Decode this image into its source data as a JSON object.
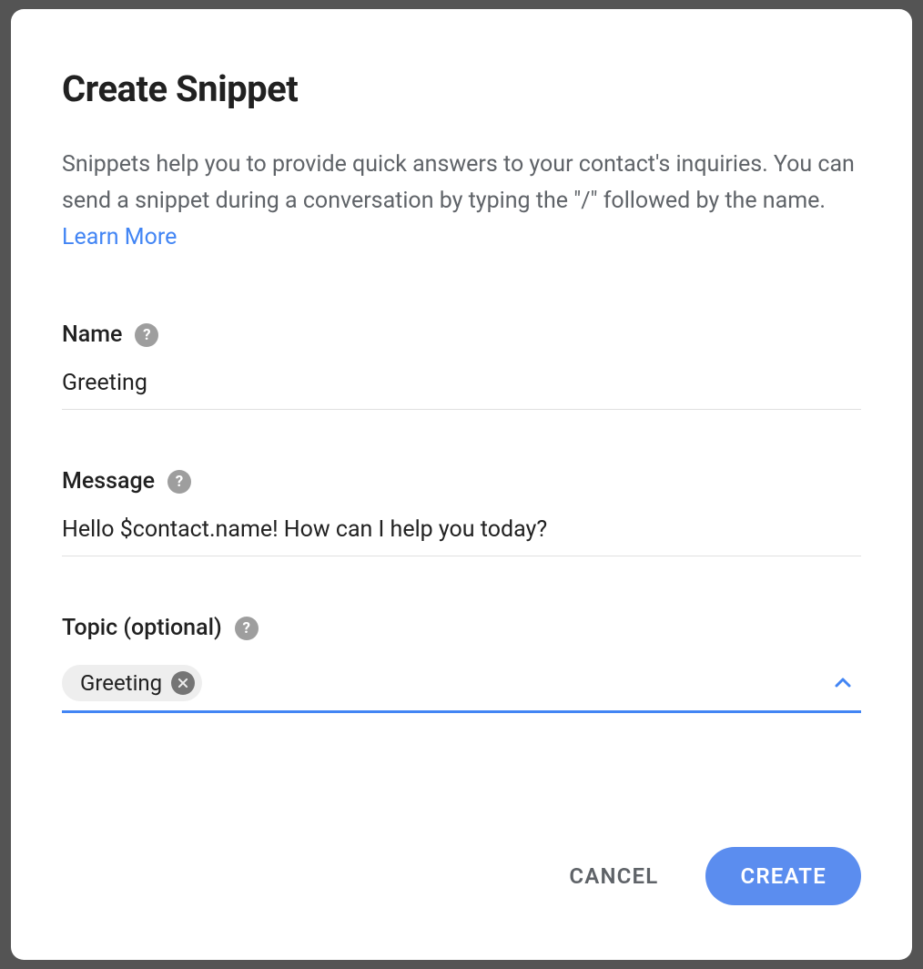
{
  "dialog": {
    "title": "Create Snippet",
    "description": "Snippets help you to provide quick answers to your contact's inquiries. You can send a snippet during a conversation by typing the \"/\" followed by the name. ",
    "learn_more": "Learn More"
  },
  "fields": {
    "name": {
      "label": "Name",
      "value": "Greeting"
    },
    "message": {
      "label": "Message",
      "value": "Hello $contact.name! How can I help you today?"
    },
    "topic": {
      "label": "Topic (optional)",
      "chips": [
        {
          "label": "Greeting"
        }
      ]
    }
  },
  "footer": {
    "cancel": "CANCEL",
    "create": "CREATE"
  },
  "colors": {
    "accent": "#4285f4",
    "primary_button": "#5b8def",
    "text": "#212121",
    "muted": "#5f6368"
  }
}
